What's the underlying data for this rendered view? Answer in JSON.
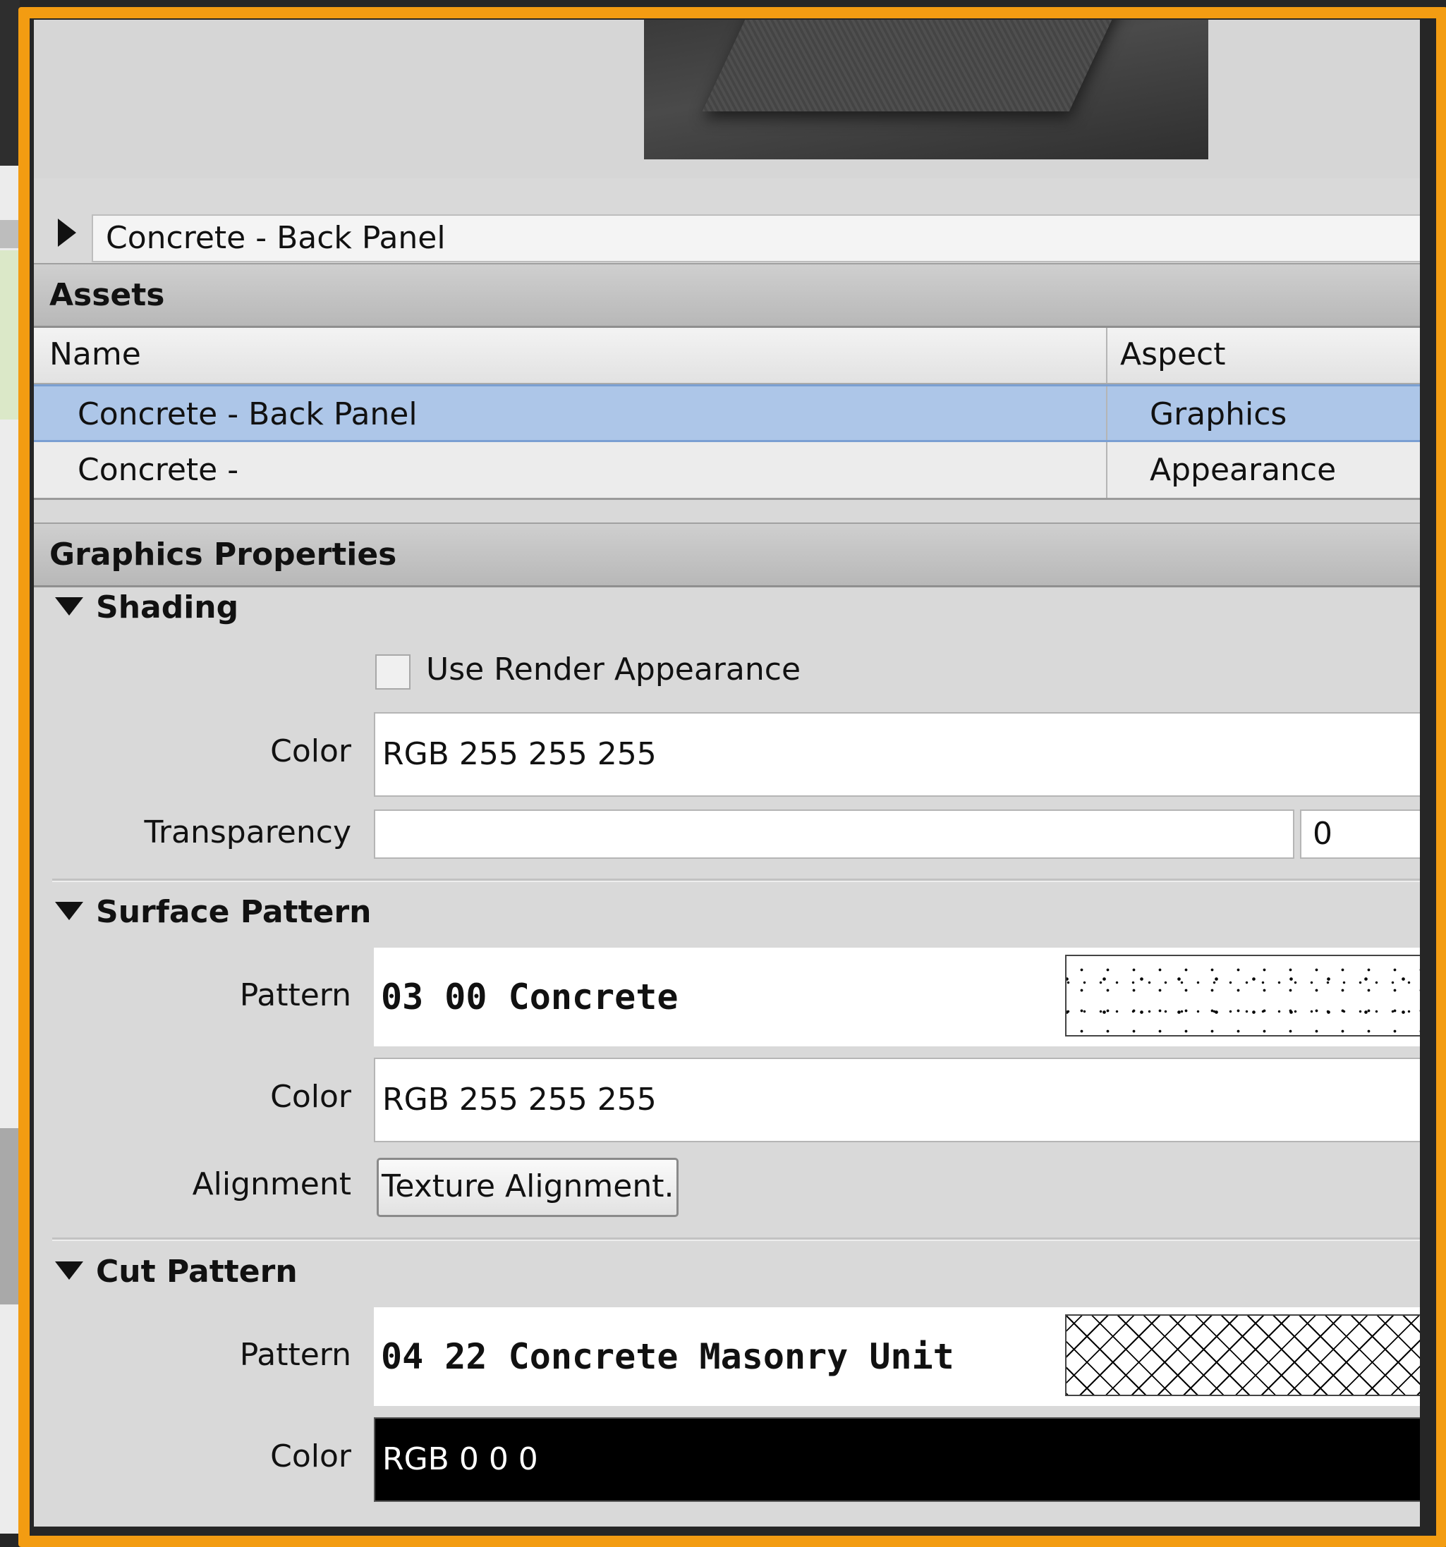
{
  "material_name": "Concrete - Back Panel",
  "assets": {
    "title": "Assets",
    "columns": {
      "name": "Name",
      "aspect": "Aspect"
    },
    "rows": [
      {
        "name": "Concrete - Back Panel",
        "aspect": "Graphics",
        "selected": true
      },
      {
        "name": "Concrete -",
        "aspect": "Appearance",
        "selected": false
      }
    ]
  },
  "graphics": {
    "title": "Graphics Properties",
    "shading": {
      "title": "Shading",
      "use_render_label": "Use Render Appearance",
      "use_render_checked": false,
      "color_label": "Color",
      "color_value": "RGB 255 255 255",
      "transparency_label": "Transparency",
      "transparency_value": "0"
    },
    "surface_pattern": {
      "title": "Surface Pattern",
      "pattern_label": "Pattern",
      "pattern_value": "03 00 Concrete",
      "color_label": "Color",
      "color_value": "RGB 255 255 255",
      "alignment_label": "Alignment",
      "alignment_button": "Texture Alignment..."
    },
    "cut_pattern": {
      "title": "Cut Pattern",
      "pattern_label": "Pattern",
      "pattern_value": "04 22 Concrete Masonry Unit",
      "color_label": "Color",
      "color_value": "RGB 0 0 0"
    }
  },
  "colors": {
    "highlight_frame": "#f39c12",
    "selected_row": "#adc6e8",
    "cut_color_swatch": "#000000"
  }
}
